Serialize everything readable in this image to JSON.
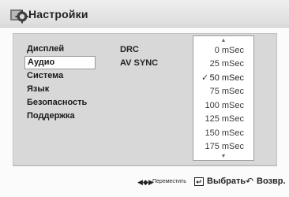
{
  "header": {
    "title": "Настройки"
  },
  "nav": {
    "items": [
      {
        "label": "Дисплей"
      },
      {
        "label": "Аудио"
      },
      {
        "label": "Система"
      },
      {
        "label": "Язык"
      },
      {
        "label": "Безопасность"
      },
      {
        "label": "Поддержка"
      }
    ],
    "selected_index": 1
  },
  "options": {
    "drc": "DRC",
    "av_sync": "AV SYNC"
  },
  "dropdown": {
    "items": [
      "0 mSec",
      "25 mSec",
      "50 mSec",
      "75 mSec",
      "100 mSec",
      "125 mSec",
      "150 mSec",
      "175 mSec"
    ],
    "checked_index": 2,
    "check_glyph": "✓"
  },
  "footer": {
    "move_label": "Переместить",
    "select_label": "Выбрать",
    "back_label": "Возвр."
  }
}
